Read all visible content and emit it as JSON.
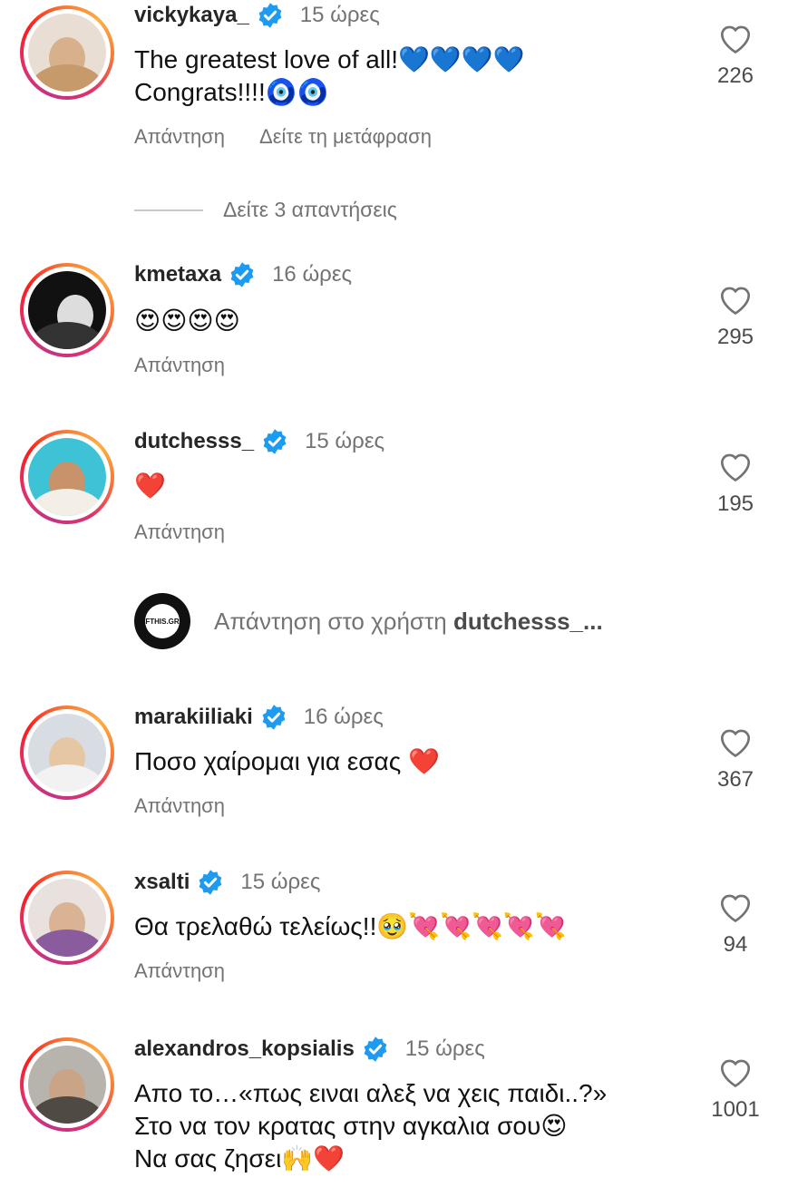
{
  "comments": [
    {
      "username": "vickykaya_",
      "time": "15 ώρες",
      "text": "The greatest love of all!💙💙💙💙\nCongrats!!!!🧿🧿",
      "reply": "Απάντηση",
      "translate": "Δείτε τη μετάφραση",
      "likes": "226"
    },
    {
      "username": "kmetaxa",
      "time": "16 ώρες",
      "text": "😍😍😍😍",
      "reply": "Απάντηση",
      "likes": "295"
    },
    {
      "username": "dutchesss_",
      "time": "15 ώρες",
      "text": "❤️",
      "reply": "Απάντηση",
      "likes": "195"
    },
    {
      "username": "marakiiliaki",
      "time": "16 ώρες",
      "text": "Ποσο χαίρομαι για εσας ❤️",
      "reply": "Απάντηση",
      "likes": "367"
    },
    {
      "username": "xsalti",
      "time": "15 ώρες",
      "text": "Θα τρελαθώ τελείως!!🥹💘💘💘💘💘",
      "reply": "Απάντηση",
      "likes": "94"
    },
    {
      "username": "alexandros_kopsialis",
      "time": "15 ώρες",
      "text": "Απο το…«πως ειναι αλεξ να χεις παιδι..?»\nΣτο να τον κρατας στην αγκαλια σου😍\nΝα σας ζησει🙌❤️",
      "likes": "1001"
    }
  ],
  "view_replies": "Δείτε 3 απαντήσεις",
  "reply_box": {
    "logo_text": "FTHIS.GR",
    "prompt": "Απάντηση στο χρήστη",
    "target_user": "dutchesss_..."
  },
  "colors": {
    "verified": "#1d9bf0",
    "secondary_text": "#737373"
  }
}
